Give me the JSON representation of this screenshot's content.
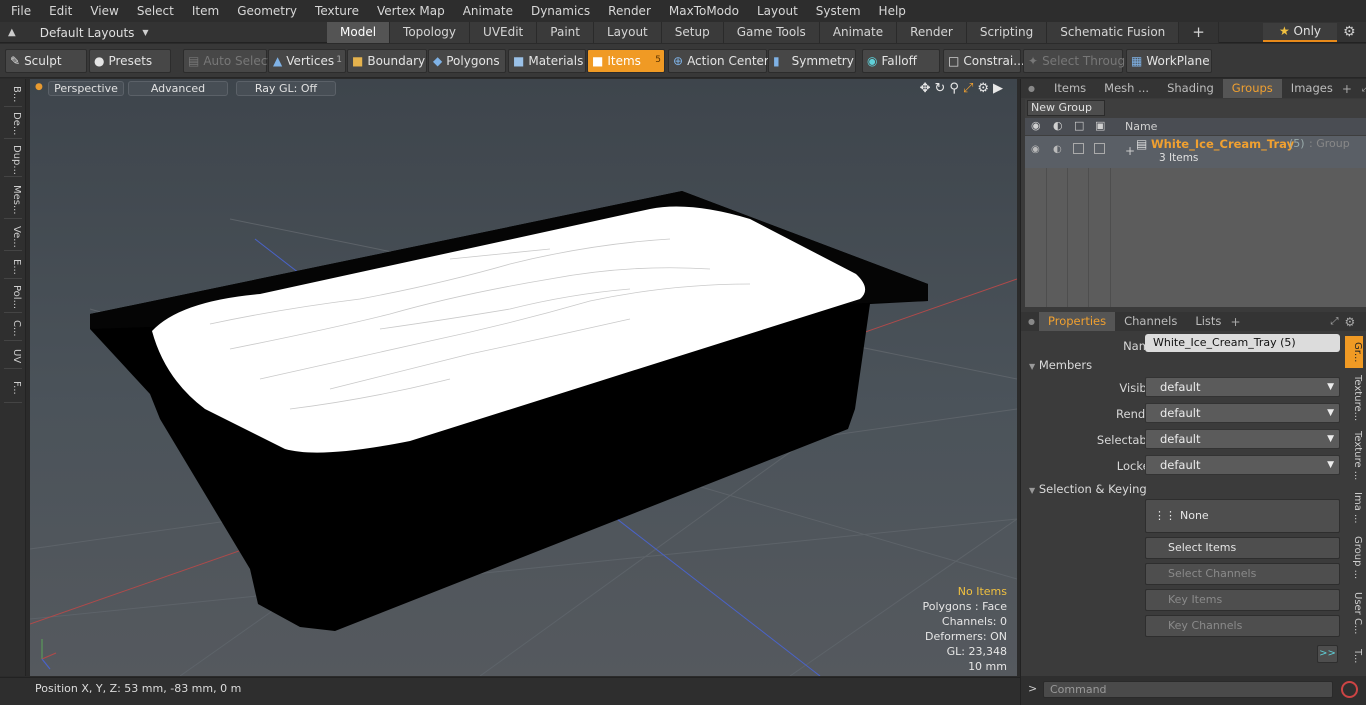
{
  "menubar": {
    "items": [
      "File",
      "Edit",
      "View",
      "Select",
      "Item",
      "Geometry",
      "Texture",
      "Vertex Map",
      "Animate",
      "Dynamics",
      "Render",
      "MaxToModo",
      "Layout",
      "System",
      "Help"
    ]
  },
  "layouts": {
    "label": "Default Layouts"
  },
  "tabs": [
    {
      "label": "Model",
      "active": true
    },
    {
      "label": "Topology"
    },
    {
      "label": "UVEdit"
    },
    {
      "label": "Paint"
    },
    {
      "label": "Layout"
    },
    {
      "label": "Setup"
    },
    {
      "label": "Game Tools"
    },
    {
      "label": "Animate"
    },
    {
      "label": "Render"
    },
    {
      "label": "Scripting"
    },
    {
      "label": "Schematic Fusion"
    }
  ],
  "only_label": "Only",
  "toolbar": {
    "sculpt": "Sculpt",
    "presets": "Presets",
    "auto_select": "Auto Select",
    "vertices": "Vertices",
    "vertices_count": "1",
    "boundary": "Boundary",
    "polygons": "Polygons",
    "materials": "Materials",
    "items": "Items",
    "items_count": "5",
    "action_center": "Action Center",
    "symmetry": "Symmetry",
    "falloff": "Falloff",
    "constraints": "Constrai...",
    "select_through": "Select Through",
    "workplane": "WorkPlane"
  },
  "left_tabs": [
    "B...",
    "De...",
    "Dup...",
    "Mes...",
    "Ve...",
    "E...",
    "Pol...",
    "C...",
    "UV",
    "F..."
  ],
  "viewport": {
    "perspective": "Perspective",
    "advanced": "Advanced",
    "raygl": "Ray GL: Off",
    "info": {
      "selection": "No Items",
      "polygons": "Polygons : Face",
      "channels": "Channels: 0",
      "deformers": "Deformers: ON",
      "gl": "GL: 23,348",
      "scale": "10 mm"
    }
  },
  "status": {
    "position": "Position X, Y, Z:   53 mm, -83 mm, 0 m"
  },
  "panel_tabs": [
    "Items",
    "Mesh ...",
    "Shading",
    "Groups",
    "Images"
  ],
  "groups": {
    "new_group": "New Group",
    "name_col": "Name",
    "group_name": "White_Ice_Cream_Tray",
    "group_count": "(5)",
    "group_type": ": Group",
    "group_items": "3 Items"
  },
  "props_tabs": [
    "Properties",
    "Channels",
    "Lists"
  ],
  "props": {
    "name_label": "Name",
    "name_value": "White_Ice_Cream_Tray (5)",
    "members": "Members",
    "visible_label": "Visible",
    "visible_value": "default",
    "render_label": "Render",
    "render_value": "default",
    "selectable_label": "Selectable",
    "selectable_value": "default",
    "locked_label": "Locked",
    "locked_value": "default",
    "sel_keying": "Selection & Keying",
    "none": "None",
    "select_items": "Select Items",
    "select_channels": "Select Channels",
    "key_items": "Key Items",
    "key_channels": "Key Channels",
    "more": ">>"
  },
  "right_vtabs": [
    "Gr...",
    "Texture...",
    "Texture ...",
    "Ima ...",
    "Group ...",
    "User C...",
    "T..."
  ],
  "command": {
    "placeholder": "Command",
    "prompt": ">"
  },
  "colors": {
    "accent": "#f09a24",
    "tray": "#000000",
    "ice_cream": "#ffffff"
  }
}
